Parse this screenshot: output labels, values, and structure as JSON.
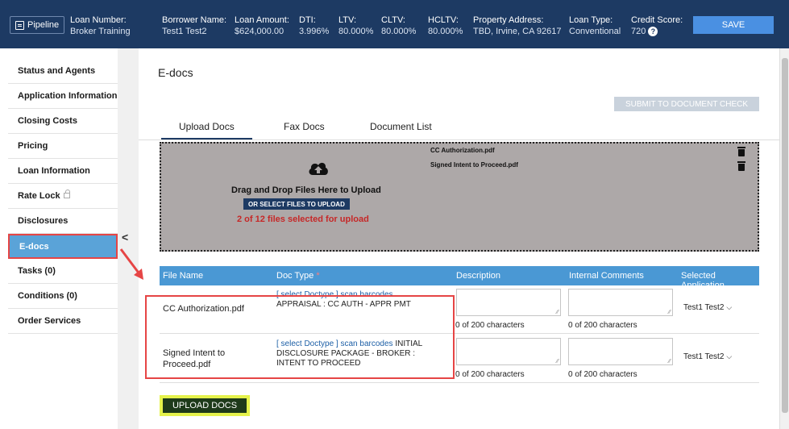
{
  "header": {
    "pipeline": "Pipeline",
    "fields": [
      {
        "label": "Loan Number:",
        "value": "Broker Training"
      },
      {
        "label": "Borrower Name:",
        "value": "Test1 Test2"
      },
      {
        "label": "Loan Amount:",
        "value": "$624,000.00"
      },
      {
        "label": "DTI:",
        "value": "3.996%"
      },
      {
        "label": "LTV:",
        "value": "80.000%"
      },
      {
        "label": "CLTV:",
        "value": "80.000%"
      },
      {
        "label": "HCLTV:",
        "value": "80.000%"
      },
      {
        "label": "Property Address:",
        "value": "TBD, Irvine, CA 92617"
      },
      {
        "label": "Loan Type:",
        "value": "Conventional"
      },
      {
        "label": "Credit Score:",
        "value": "720"
      }
    ],
    "save": "SAVE"
  },
  "sidebar": {
    "items": [
      {
        "label": "Status and Agents"
      },
      {
        "label": "Application Information"
      },
      {
        "label": "Closing Costs"
      },
      {
        "label": "Pricing"
      },
      {
        "label": "Loan Information"
      },
      {
        "label": "Rate Lock"
      },
      {
        "label": "Disclosures"
      },
      {
        "label": "E-docs"
      },
      {
        "label": "Tasks (0)"
      },
      {
        "label": "Conditions (0)"
      },
      {
        "label": "Order Services"
      }
    ]
  },
  "main": {
    "title": "E-docs",
    "submit": "SUBMIT TO DOCUMENT CHECK",
    "tabs": [
      "Upload Docs",
      "Fax Docs",
      "Document List"
    ],
    "dropzone": {
      "text": "Drag and Drop Files Here to Upload",
      "button": "OR SELECT FILES TO UPLOAD",
      "count": "2 of 12 files selected for upload",
      "files": [
        "CC Authorization.pdf",
        "Signed Intent to Proceed.pdf"
      ]
    },
    "columns": [
      "File Name",
      "Doc Type",
      "Description",
      "Internal Comments",
      "Selected Application"
    ],
    "rows": [
      {
        "file": "CC Authorization.pdf",
        "link1": "[ select Doctype ]",
        "link2": "scan barcodes",
        "doctype": "APPRAISAL : CC AUTH - APPR PMT",
        "desc_chars": "0 of 200 characters",
        "comm_chars": "0 of 200 characters",
        "app": "Test1 Test2"
      },
      {
        "file": "Signed Intent to Proceed.pdf",
        "link1": "[ select Doctype ]",
        "link2": "scan barcodes",
        "doctype": "INITIAL DISCLOSURE PACKAGE - BROKER : INTENT TO PROCEED",
        "desc_chars": "0 of 200 characters",
        "comm_chars": "0 of 200 characters",
        "app": "Test1 Test2"
      }
    ],
    "upload": "UPLOAD DOCS"
  }
}
